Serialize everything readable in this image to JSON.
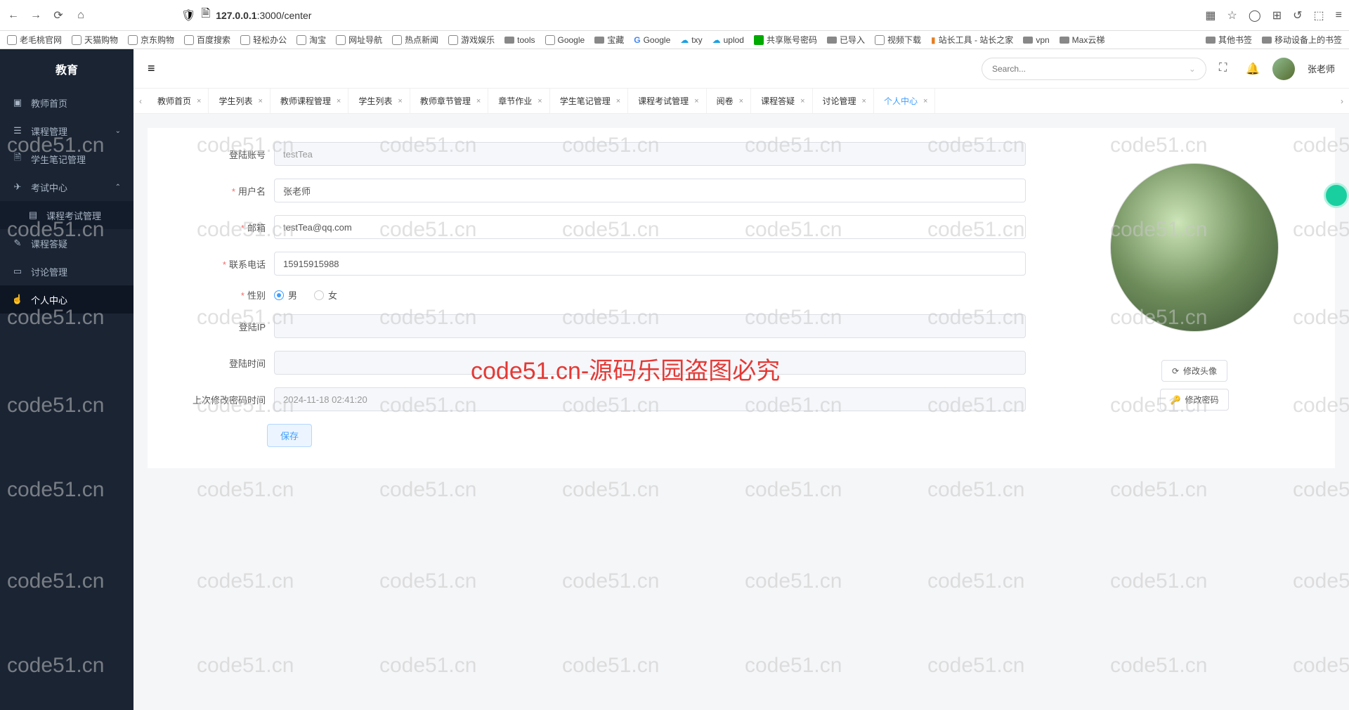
{
  "browser": {
    "url_host": "127.0.0.1",
    "url_path": ":3000/center"
  },
  "bookmarks": [
    {
      "label": "老毛桃官网",
      "type": "globe"
    },
    {
      "label": "天猫购物",
      "type": "globe"
    },
    {
      "label": "京东购物",
      "type": "globe"
    },
    {
      "label": "百度搜索",
      "type": "globe"
    },
    {
      "label": "轻松办公",
      "type": "globe"
    },
    {
      "label": "淘宝",
      "type": "globe"
    },
    {
      "label": "网址导航",
      "type": "globe"
    },
    {
      "label": "热点新闻",
      "type": "globe"
    },
    {
      "label": "游戏娱乐",
      "type": "globe"
    },
    {
      "label": "tools",
      "type": "folder"
    },
    {
      "label": "Google",
      "type": "globe"
    },
    {
      "label": "宝藏",
      "type": "folder"
    },
    {
      "label": "Google",
      "type": "g"
    },
    {
      "label": "txy",
      "type": "cloud"
    },
    {
      "label": "uplod",
      "type": "cloud"
    },
    {
      "label": "共享账号密码",
      "type": "green"
    },
    {
      "label": "已导入",
      "type": "folder"
    },
    {
      "label": "视频下载",
      "type": "globe"
    },
    {
      "label": "站长工具 - 站长之家",
      "type": "tool"
    },
    {
      "label": "vpn",
      "type": "folder"
    },
    {
      "label": "Max云梯",
      "type": "folder"
    }
  ],
  "bookmarks_right": [
    {
      "label": "其他书签",
      "type": "folder"
    },
    {
      "label": "移动设备上的书签",
      "type": "folder"
    }
  ],
  "sidebar": {
    "title": "教育",
    "items": [
      {
        "icon": "home",
        "label": "教师首页"
      },
      {
        "icon": "book",
        "label": "课程管理",
        "chevron": "down"
      },
      {
        "icon": "note",
        "label": "学生笔记管理"
      },
      {
        "icon": "exam",
        "label": "考试中心",
        "chevron": "up"
      },
      {
        "icon": "sub",
        "label": "课程考试管理",
        "sub": true
      },
      {
        "icon": "qa",
        "label": "课程答疑"
      },
      {
        "icon": "discuss",
        "label": "讨论管理"
      },
      {
        "icon": "user",
        "label": "个人中心",
        "active": true
      }
    ]
  },
  "header": {
    "search_placeholder": "Search...",
    "username": "张老师"
  },
  "tabs": [
    {
      "label": "教师首页"
    },
    {
      "label": "学生列表"
    },
    {
      "label": "教师课程管理"
    },
    {
      "label": "学生列表"
    },
    {
      "label": "教师章节管理"
    },
    {
      "label": "章节作业"
    },
    {
      "label": "学生笔记管理"
    },
    {
      "label": "课程考试管理"
    },
    {
      "label": "阅卷"
    },
    {
      "label": "课程答疑"
    },
    {
      "label": "讨论管理"
    },
    {
      "label": "个人中心",
      "active": true
    }
  ],
  "form": {
    "login_account_label": "登陆账号",
    "login_account": "testTea",
    "username_label": "用户名",
    "username": "张老师",
    "email_label": "邮箱",
    "email": "testTea@qq.com",
    "phone_label": "联系电话",
    "phone": "15915915988",
    "gender_label": "性别",
    "gender_male": "男",
    "gender_female": "女",
    "gender_selected": "male",
    "login_ip_label": "登陆IP",
    "login_ip": "",
    "login_time_label": "登陆时间",
    "login_time": "",
    "pwd_time_label": "上次修改密码时间",
    "pwd_time": "2024-11-18 02:41:20",
    "save": "保存"
  },
  "avatar_actions": {
    "change_avatar": "修改头像",
    "change_password": "修改密码"
  },
  "watermark_text": "code51.cn",
  "watermark_red": "code51.cn-源码乐园盗图必究"
}
